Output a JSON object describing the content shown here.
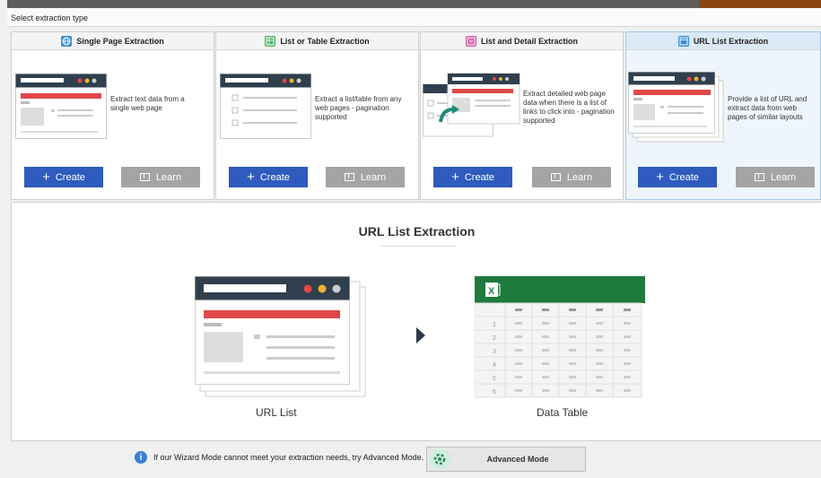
{
  "section_label": "Select extraction type",
  "cards": [
    {
      "title": "Single Page Extraction",
      "description": "Extract text data from a single web page",
      "create_label": "Create",
      "learn_label": "Learn",
      "icon": "globe-icon",
      "icon_color": "#3a8fd8"
    },
    {
      "title": "List or Table Extraction",
      "description": "Extract a list/table from any web pages - pagination supported",
      "create_label": "Create",
      "learn_label": "Learn",
      "icon": "table-icon",
      "icon_color": "#54b36b"
    },
    {
      "title": "List and Detail Extraction",
      "description": "Extract detailed web page data when there is a list of links to click into - pagination supported",
      "create_label": "Create",
      "learn_label": "Learn",
      "icon": "list-detail-icon",
      "icon_color": "#d45aa6"
    },
    {
      "title": "URL List Extraction",
      "description": "Provide a list of URL and extract data from web pages of similar layouts",
      "create_label": "Create",
      "learn_label": "Learn",
      "icon": "url-list-icon",
      "icon_color": "#3a8fd8",
      "selected": true
    }
  ],
  "detail": {
    "title": "URL List Extraction",
    "left_caption": "URL List",
    "right_caption": "Data Table",
    "row_numbers": [
      "1",
      "2",
      "3",
      "4",
      "5",
      "6"
    ]
  },
  "bottom": {
    "info_text": "If our Wizard Mode cannot meet your extraction needs, try Advanced Mode.",
    "advanced_label": "Advanced Mode"
  },
  "colors": {
    "accent_blue": "#2e5bbd",
    "learn_gray": "#a4a4a4",
    "browser_dark": "#2f3f4d",
    "red_bar": "#e04848",
    "excel_green": "#1f7a3d"
  }
}
